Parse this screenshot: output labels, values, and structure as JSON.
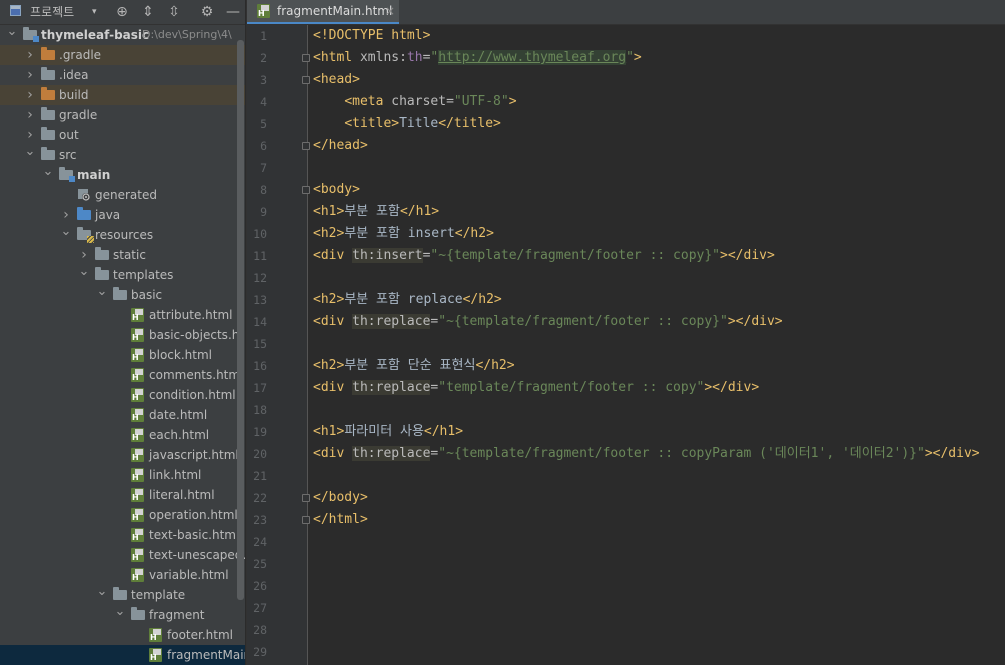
{
  "project_panel": {
    "title": "프로젝트",
    "toolbar_icons": [
      "locate-icon",
      "expand-all-icon",
      "collapse-all-icon",
      "gear-icon",
      "minimize-icon"
    ],
    "toolbar_glyphs": {
      "caret": "▾",
      "locate": "⊕",
      "expand": "⇕",
      "collapse": "⇳",
      "gear": "⚙",
      "minimize": "—"
    },
    "root": {
      "name": "thymeleaf-basic",
      "path": "D:\\dev\\Spring\\4\\"
    },
    "tree": [
      {
        "label": "thymeleaf-basic",
        "depth": 0,
        "expanded": true,
        "icon": "module-icon",
        "bold": true
      },
      {
        "label": ".gradle",
        "depth": 1,
        "expanded": false,
        "icon": "folder-orange",
        "excluded": true
      },
      {
        "label": ".idea",
        "depth": 1,
        "expanded": false,
        "icon": "folder-gray"
      },
      {
        "label": "build",
        "depth": 1,
        "expanded": false,
        "icon": "folder-orange",
        "excluded": true
      },
      {
        "label": "gradle",
        "depth": 1,
        "expanded": false,
        "icon": "folder-gray"
      },
      {
        "label": "out",
        "depth": 1,
        "expanded": false,
        "icon": "folder-gray"
      },
      {
        "label": "src",
        "depth": 1,
        "expanded": true,
        "icon": "folder-gray"
      },
      {
        "label": "main",
        "depth": 2,
        "expanded": true,
        "icon": "folder-module",
        "bold": true
      },
      {
        "label": "generated",
        "depth": 3,
        "expanded": null,
        "icon": "generated-icon"
      },
      {
        "label": "java",
        "depth": 3,
        "expanded": false,
        "icon": "folder-blue"
      },
      {
        "label": "resources",
        "depth": 3,
        "expanded": true,
        "icon": "folder-resources"
      },
      {
        "label": "static",
        "depth": 4,
        "expanded": false,
        "icon": "folder-gray"
      },
      {
        "label": "templates",
        "depth": 4,
        "expanded": true,
        "icon": "folder-gray"
      },
      {
        "label": "basic",
        "depth": 5,
        "expanded": true,
        "icon": "folder-gray"
      },
      {
        "label": "attribute.html",
        "depth": 6,
        "expanded": null,
        "icon": "html-file-icon"
      },
      {
        "label": "basic-objects.html",
        "depth": 6,
        "expanded": null,
        "icon": "html-file-icon"
      },
      {
        "label": "block.html",
        "depth": 6,
        "expanded": null,
        "icon": "html-file-icon"
      },
      {
        "label": "comments.html",
        "depth": 6,
        "expanded": null,
        "icon": "html-file-icon"
      },
      {
        "label": "condition.html",
        "depth": 6,
        "expanded": null,
        "icon": "html-file-icon"
      },
      {
        "label": "date.html",
        "depth": 6,
        "expanded": null,
        "icon": "html-file-icon"
      },
      {
        "label": "each.html",
        "depth": 6,
        "expanded": null,
        "icon": "html-file-icon"
      },
      {
        "label": "javascript.html",
        "depth": 6,
        "expanded": null,
        "icon": "html-file-icon"
      },
      {
        "label": "link.html",
        "depth": 6,
        "expanded": null,
        "icon": "html-file-icon"
      },
      {
        "label": "literal.html",
        "depth": 6,
        "expanded": null,
        "icon": "html-file-icon"
      },
      {
        "label": "operation.html",
        "depth": 6,
        "expanded": null,
        "icon": "html-file-icon"
      },
      {
        "label": "text-basic.html",
        "depth": 6,
        "expanded": null,
        "icon": "html-file-icon"
      },
      {
        "label": "text-unescaped.ht",
        "depth": 6,
        "expanded": null,
        "icon": "html-file-icon"
      },
      {
        "label": "variable.html",
        "depth": 6,
        "expanded": null,
        "icon": "html-file-icon"
      },
      {
        "label": "template",
        "depth": 5,
        "expanded": true,
        "icon": "folder-gray"
      },
      {
        "label": "fragment",
        "depth": 6,
        "expanded": true,
        "icon": "folder-gray"
      },
      {
        "label": "footer.html",
        "depth": 7,
        "expanded": null,
        "icon": "html-file-icon"
      },
      {
        "label": "fragmentMain.",
        "depth": 7,
        "expanded": null,
        "icon": "html-file-icon",
        "selected": true
      }
    ]
  },
  "editor": {
    "tab": {
      "label": "fragmentMain.html",
      "close": "×"
    },
    "line_numbers": [
      "1",
      "2",
      "3",
      "4",
      "5",
      "6",
      "7",
      "8",
      "9",
      "10",
      "11",
      "12",
      "13",
      "14",
      "15",
      "16",
      "17",
      "18",
      "19",
      "20",
      "21",
      "22",
      "23",
      "24",
      "25",
      "26",
      "27",
      "28",
      "29"
    ],
    "lines": [
      [
        {
          "t": "<!DOCTYPE html>",
          "c": "c-doctype"
        }
      ],
      [
        {
          "t": "<html ",
          "c": "c-tag"
        },
        {
          "t": "xmlns:",
          "c": "c-attr"
        },
        {
          "t": "th",
          "c": "c-ns"
        },
        {
          "t": "=",
          "c": "c-attr"
        },
        {
          "t": "\"",
          "c": "c-val"
        },
        {
          "t": "http://www.thymeleaf.org",
          "c": "c-url"
        },
        {
          "t": "\"",
          "c": "c-val"
        },
        {
          "t": ">",
          "c": "c-tag"
        }
      ],
      [
        {
          "t": "<head>",
          "c": "c-tag"
        }
      ],
      [
        {
          "t": "    ",
          "c": "c-text"
        },
        {
          "t": "<meta ",
          "c": "c-tag"
        },
        {
          "t": "charset",
          "c": "c-attr"
        },
        {
          "t": "=",
          "c": "c-attr"
        },
        {
          "t": "\"UTF-8\"",
          "c": "c-val"
        },
        {
          "t": ">",
          "c": "c-tag"
        }
      ],
      [
        {
          "t": "    ",
          "c": "c-text"
        },
        {
          "t": "<title>",
          "c": "c-tag"
        },
        {
          "t": "Title",
          "c": "c-text"
        },
        {
          "t": "</title>",
          "c": "c-tag"
        }
      ],
      [
        {
          "t": "</head>",
          "c": "c-tag"
        }
      ],
      [],
      [
        {
          "t": "<body>",
          "c": "c-tag"
        }
      ],
      [
        {
          "t": "<h1>",
          "c": "c-tag"
        },
        {
          "t": "부분 포함",
          "c": "c-text"
        },
        {
          "t": "</h1>",
          "c": "c-tag"
        }
      ],
      [
        {
          "t": "<h2>",
          "c": "c-tag"
        },
        {
          "t": "부분 포함 insert",
          "c": "c-text"
        },
        {
          "t": "</h2>",
          "c": "c-tag"
        }
      ],
      [
        {
          "t": "<div ",
          "c": "c-tag"
        },
        {
          "t": "th",
          "c": "c-ns c-thattr"
        },
        {
          "t": ":insert",
          "c": "c-thattr"
        },
        {
          "t": "=",
          "c": "c-attr"
        },
        {
          "t": "\"~{template/fragment/footer :: copy}\"",
          "c": "c-val"
        },
        {
          "t": "></div>",
          "c": "c-tag"
        }
      ],
      [],
      [
        {
          "t": "<h2>",
          "c": "c-tag"
        },
        {
          "t": "부분 포함 replace",
          "c": "c-text"
        },
        {
          "t": "</h2>",
          "c": "c-tag"
        }
      ],
      [
        {
          "t": "<div ",
          "c": "c-tag"
        },
        {
          "t": "th",
          "c": "c-ns c-thattr"
        },
        {
          "t": ":replace",
          "c": "c-thattr"
        },
        {
          "t": "=",
          "c": "c-attr"
        },
        {
          "t": "\"~{template/fragment/footer :: copy}\"",
          "c": "c-val"
        },
        {
          "t": "></div>",
          "c": "c-tag"
        }
      ],
      [],
      [
        {
          "t": "<h2>",
          "c": "c-tag"
        },
        {
          "t": "부분 포함 단순 표현식",
          "c": "c-text"
        },
        {
          "t": "</h2>",
          "c": "c-tag"
        }
      ],
      [
        {
          "t": "<div ",
          "c": "c-tag"
        },
        {
          "t": "th",
          "c": "c-ns c-thattr"
        },
        {
          "t": ":replace",
          "c": "c-thattr"
        },
        {
          "t": "=",
          "c": "c-attr"
        },
        {
          "t": "\"template/fragment/footer :: copy\"",
          "c": "c-val"
        },
        {
          "t": "></div>",
          "c": "c-tag"
        }
      ],
      [],
      [
        {
          "t": "<h1>",
          "c": "c-tag"
        },
        {
          "t": "파라미터 사용",
          "c": "c-text"
        },
        {
          "t": "</h1>",
          "c": "c-tag"
        }
      ],
      [
        {
          "t": "<div ",
          "c": "c-tag"
        },
        {
          "t": "th",
          "c": "c-ns c-thattr"
        },
        {
          "t": ":replace",
          "c": "c-thattr"
        },
        {
          "t": "=",
          "c": "c-attr"
        },
        {
          "t": "\"~{template/fragment/footer :: copyParam ('데이터1', '데이터2')}\"",
          "c": "c-val"
        },
        {
          "t": "></div>",
          "c": "c-tag"
        }
      ],
      [],
      [
        {
          "t": "</body>",
          "c": "c-tag"
        }
      ],
      [
        {
          "t": "</html>",
          "c": "c-tag"
        }
      ],
      [],
      [],
      [],
      [],
      [],
      []
    ],
    "fold_marker_lines": [
      2,
      3,
      6,
      8,
      22,
      23
    ]
  },
  "colors": {
    "panel_bg": "#3c3f41",
    "editor_bg": "#2b2b2b",
    "gutter_bg": "#313335",
    "tag": "#e8bf6a",
    "attribute": "#bababa",
    "namespace": "#9876aa",
    "string": "#6a8759",
    "selection": "#0d293e",
    "excluded": "#494336"
  }
}
